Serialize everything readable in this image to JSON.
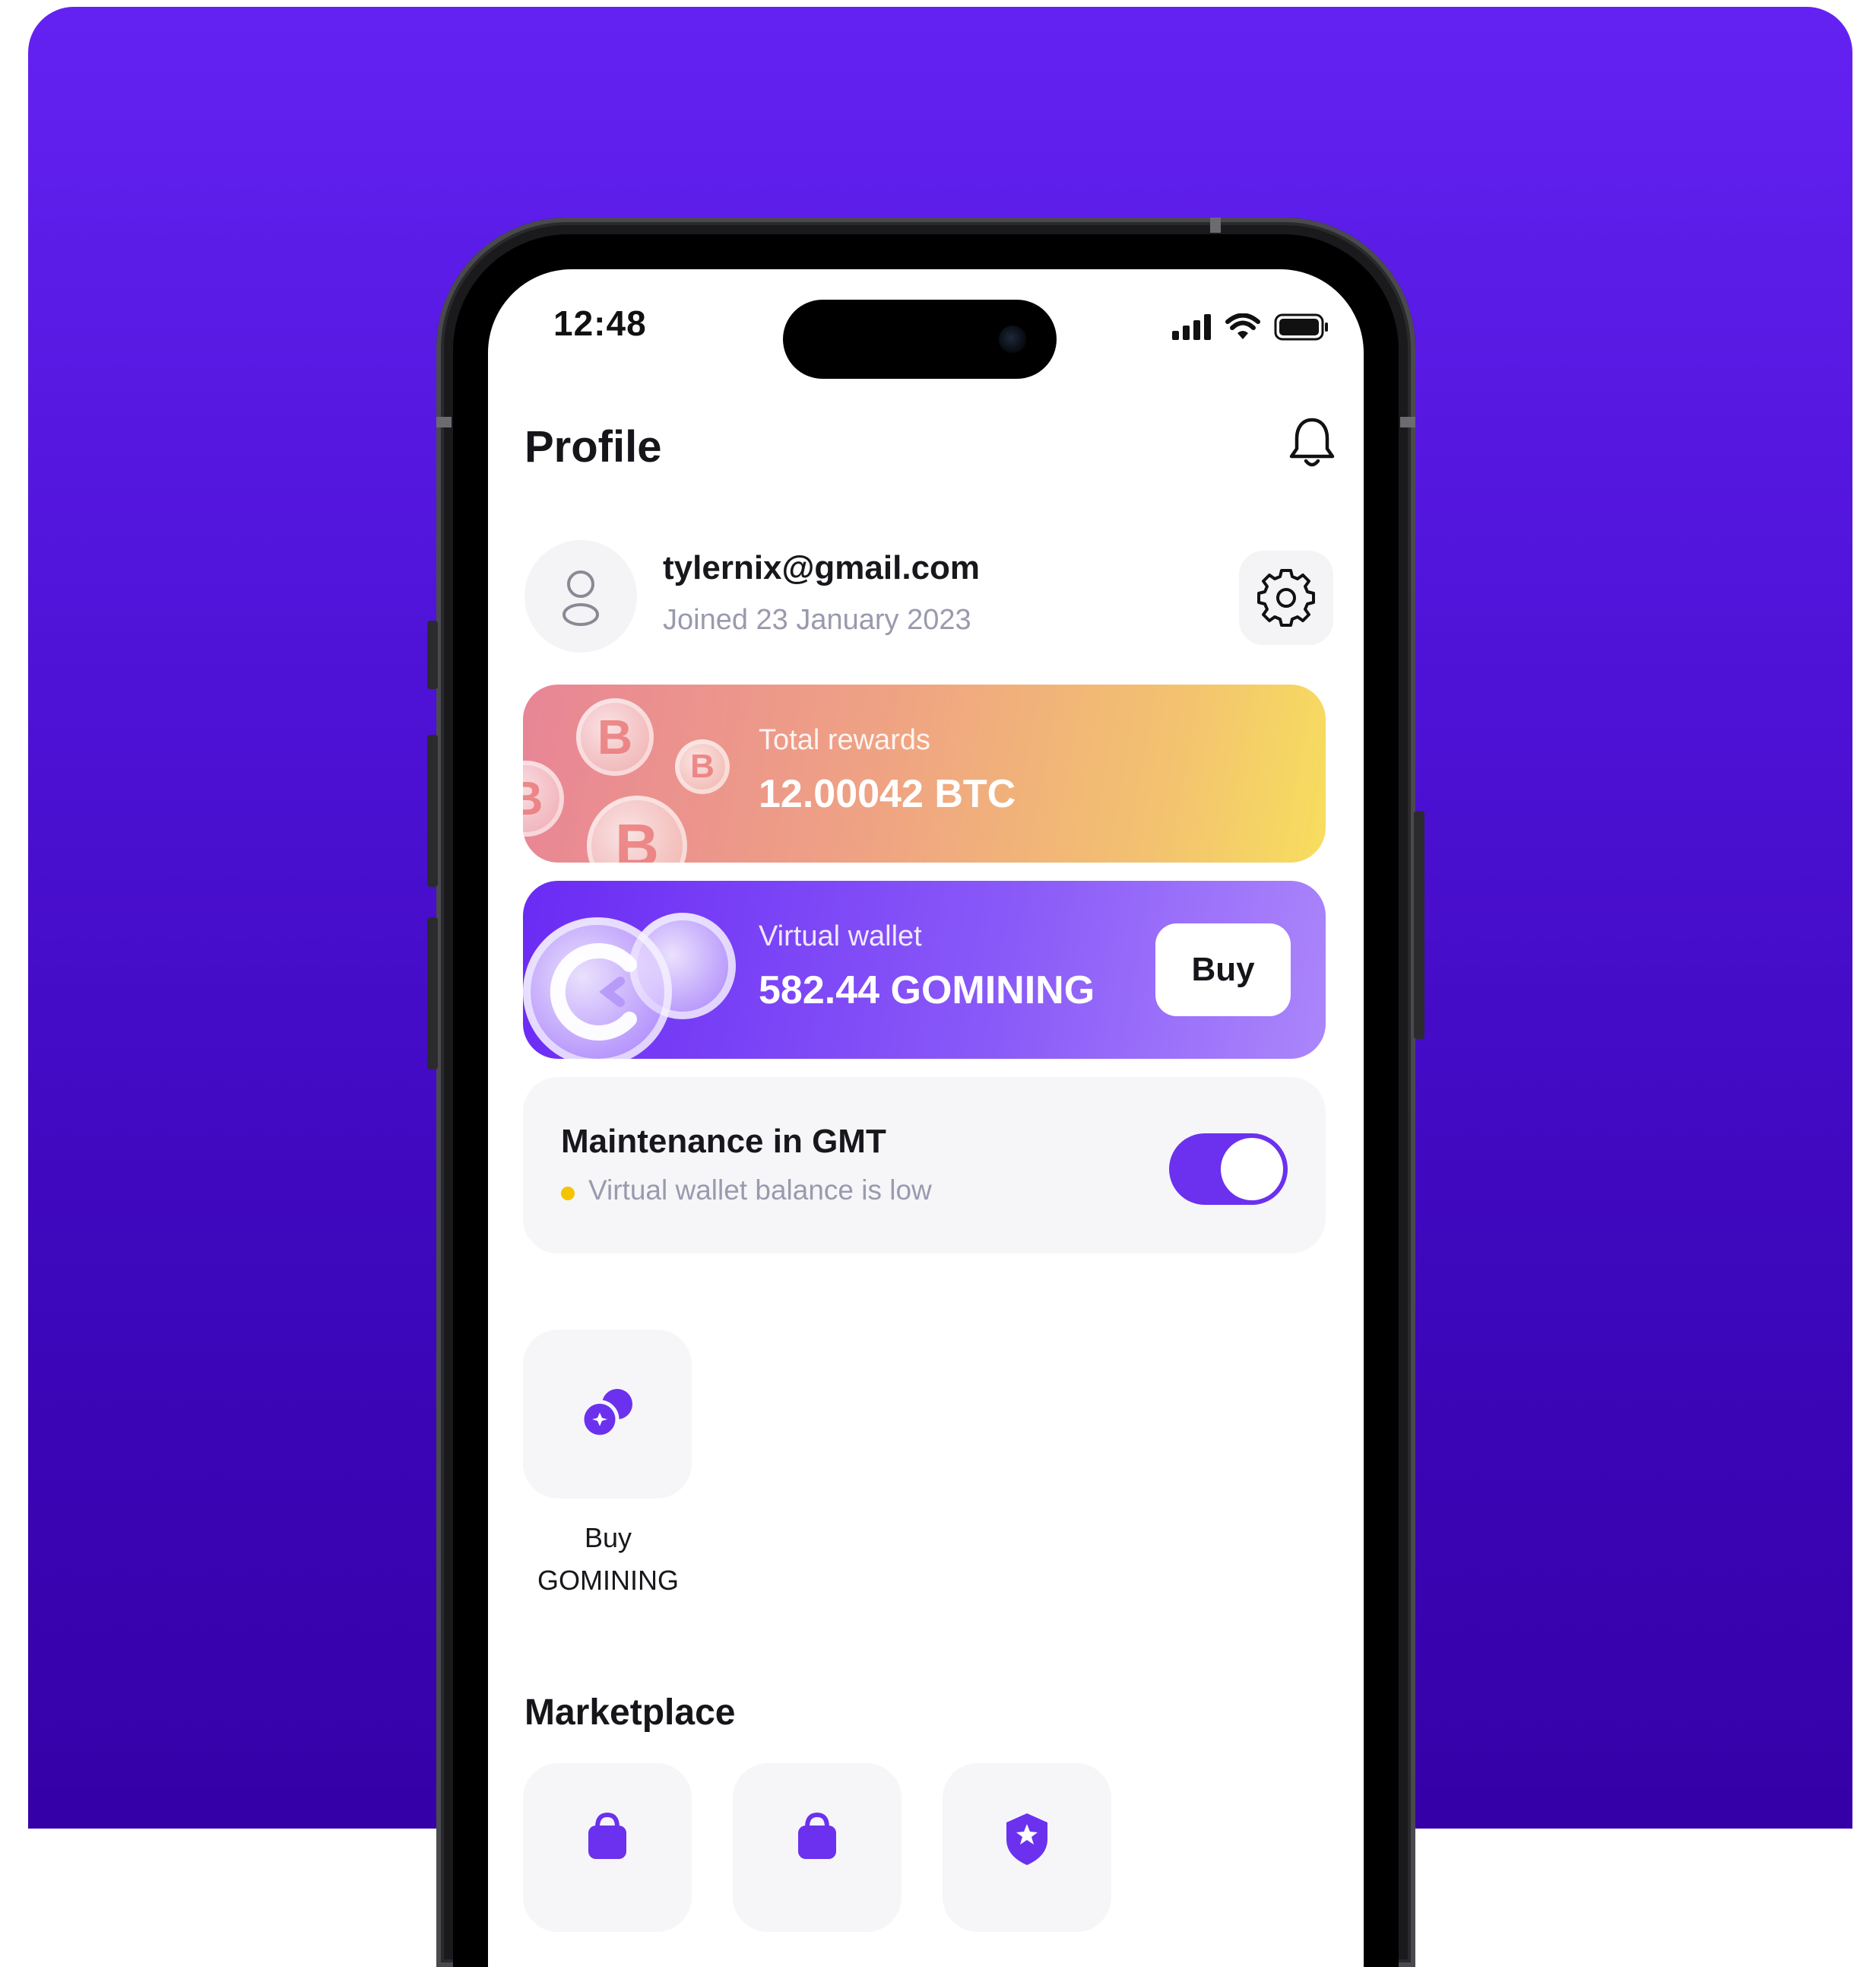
{
  "status_bar": {
    "time": "12:48"
  },
  "header": {
    "title": "Profile"
  },
  "profile": {
    "email": "tylernix@gmail.com",
    "joined": "Joined 23 January 2023"
  },
  "rewards_card": {
    "label": "Total rewards",
    "value": "12.00042 BTC",
    "coin_symbol": "B"
  },
  "wallet_card": {
    "label": "Virtual wallet",
    "value": "582.44 GOMINING",
    "buy_label": "Buy"
  },
  "maintenance": {
    "title": "Maintenance in GMT",
    "status": "Virtual wallet balance is low",
    "toggle_on": true
  },
  "actions": [
    {
      "label_line1": "Buy",
      "label_line2": "GOMINING",
      "icon": "coins-icon"
    }
  ],
  "marketplace": {
    "title": "Marketplace",
    "tiles": [
      {
        "icon": "shopping-bag-icon"
      },
      {
        "icon": "shopping-bag-icon"
      },
      {
        "icon": "shield-icon"
      }
    ]
  },
  "colors": {
    "background_top": "#6422f2",
    "background_bottom": "#3600a8",
    "accent": "#6b31ee",
    "warning_dot": "#f5c400"
  }
}
